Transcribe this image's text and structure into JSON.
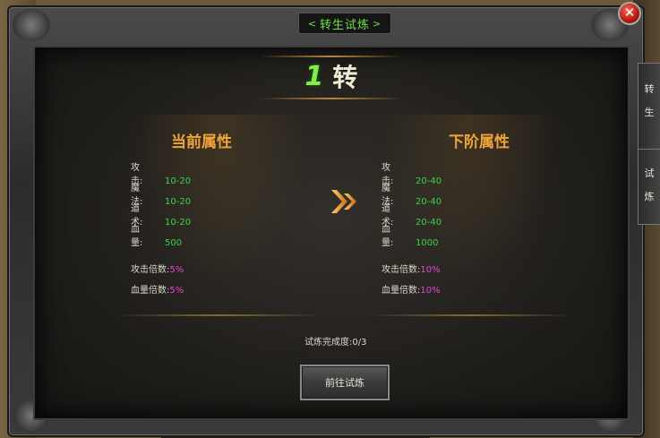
{
  "window": {
    "title": "转生试炼",
    "close_icon": "close-icon"
  },
  "header": {
    "rank_number": "1",
    "rank_word": "转"
  },
  "current": {
    "title": "当前属性",
    "attrs": [
      {
        "label": "攻　　击:",
        "value": "10-20"
      },
      {
        "label": "魔　　法:",
        "value": "10-20"
      },
      {
        "label": "道　　术:",
        "value": "10-20"
      },
      {
        "label": "血　　量:",
        "value": "500"
      }
    ],
    "multipliers": [
      {
        "label": "攻击倍数:",
        "value": "5%"
      },
      {
        "label": "血量倍数:",
        "value": "5%"
      }
    ]
  },
  "next": {
    "title": "下阶属性",
    "attrs": [
      {
        "label": "攻　　击:",
        "value": "20-40"
      },
      {
        "label": "魔　　法:",
        "value": "20-40"
      },
      {
        "label": "道　　术:",
        "value": "20-40"
      },
      {
        "label": "血　　量:",
        "value": "1000"
      }
    ],
    "multipliers": [
      {
        "label": "攻击倍数:",
        "value": "10%"
      },
      {
        "label": "血量倍数:",
        "value": "10%"
      }
    ]
  },
  "progress": {
    "label": "试炼完成度:",
    "value": "0/3"
  },
  "button": {
    "label": "前往试炼"
  },
  "side_tabs": [
    {
      "chars": [
        "转",
        "生"
      ]
    },
    {
      "chars": [
        "试",
        "炼"
      ]
    }
  ],
  "colors": {
    "accent_green": "#39d24a",
    "percent_magenta": "#e04ad2",
    "title_orange": "#f0a43c"
  }
}
